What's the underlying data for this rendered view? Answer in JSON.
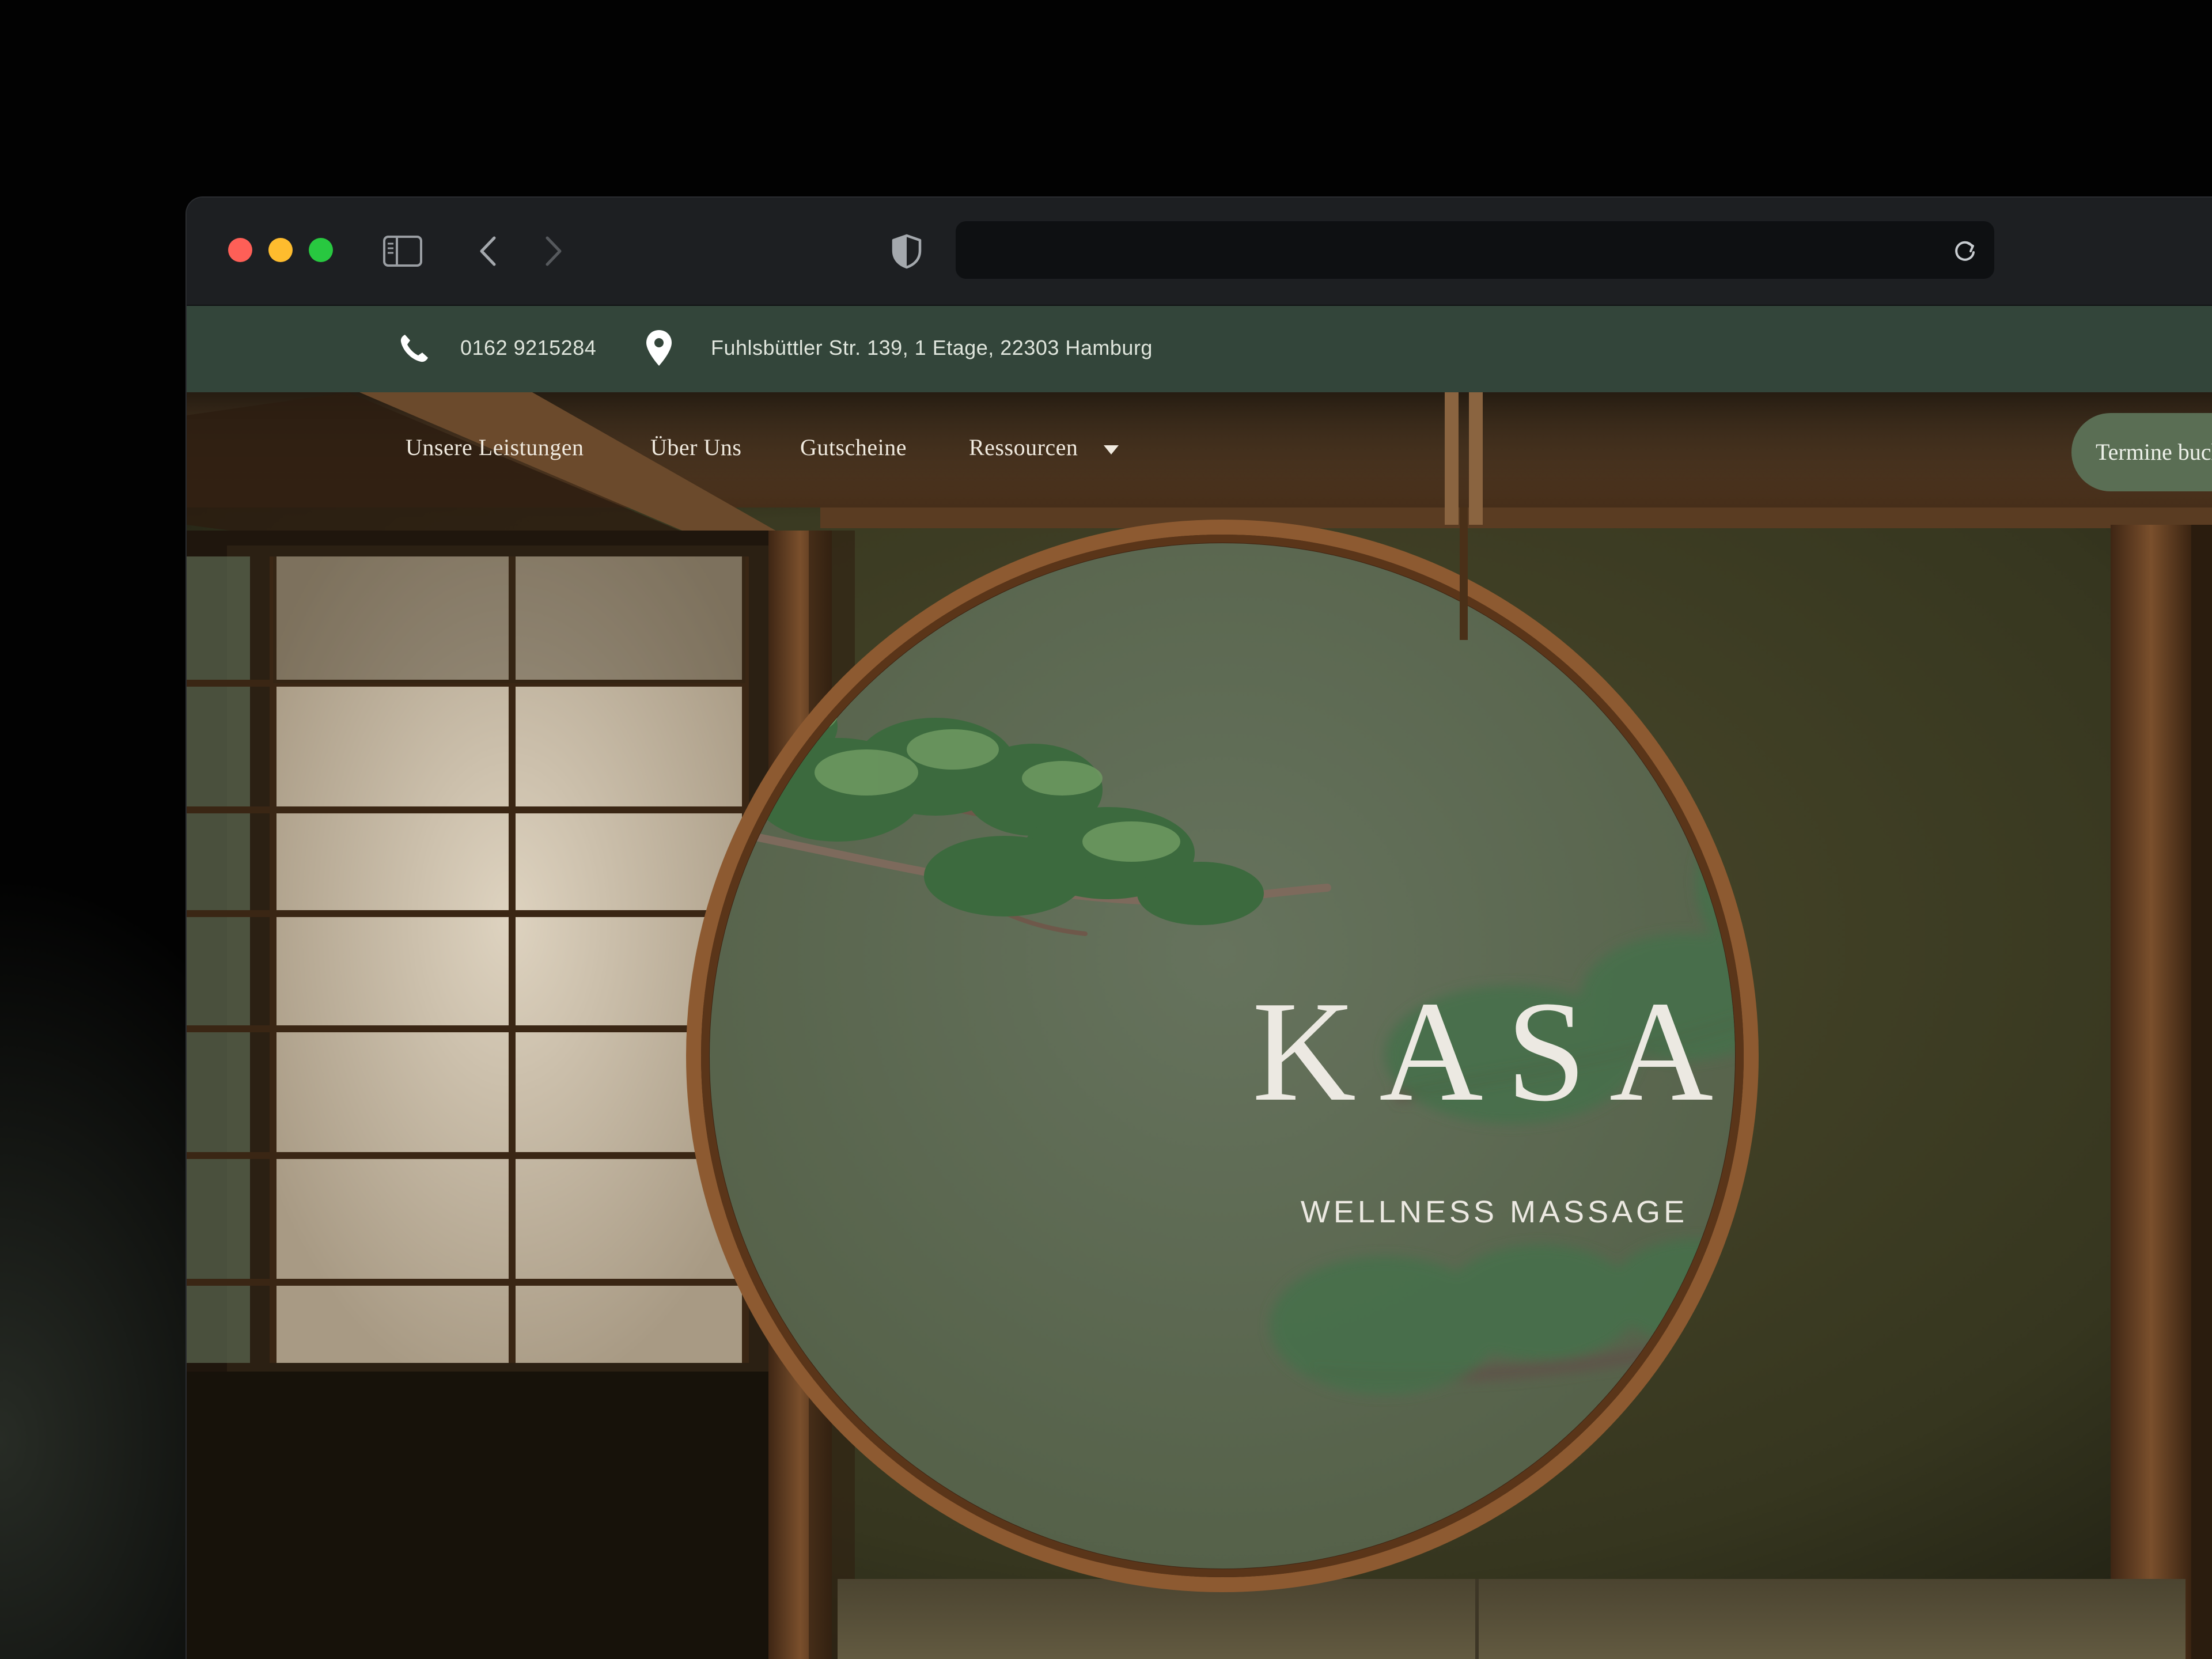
{
  "browser": {
    "url": ""
  },
  "topbar": {
    "phone": "0162 9215284",
    "address": "Fuhlsbüttler Str. 139, 1 Etage, 22303 Hamburg"
  },
  "nav": {
    "items": [
      {
        "label": "Unsere Leistungen"
      },
      {
        "label": "Über Uns"
      },
      {
        "label": "Gutscheine"
      },
      {
        "label": "Ressourcen"
      }
    ],
    "cta_label": "Termine buchen"
  },
  "hero": {
    "title": "KASA",
    "subtitle": "WELLNESS MASSAGE"
  },
  "colors": {
    "topbar_green": "#33453a",
    "cta_green": "#5a6e54",
    "wall_olive": "#3b3b23",
    "circle_green": "#5e6a55",
    "wood": "#7a4f2c"
  },
  "icons": [
    "sidebar-icon",
    "chevron-left-icon",
    "chevron-right-icon",
    "shield-icon",
    "reload-icon",
    "phone-icon",
    "location-pin-icon",
    "caret-down-icon"
  ]
}
